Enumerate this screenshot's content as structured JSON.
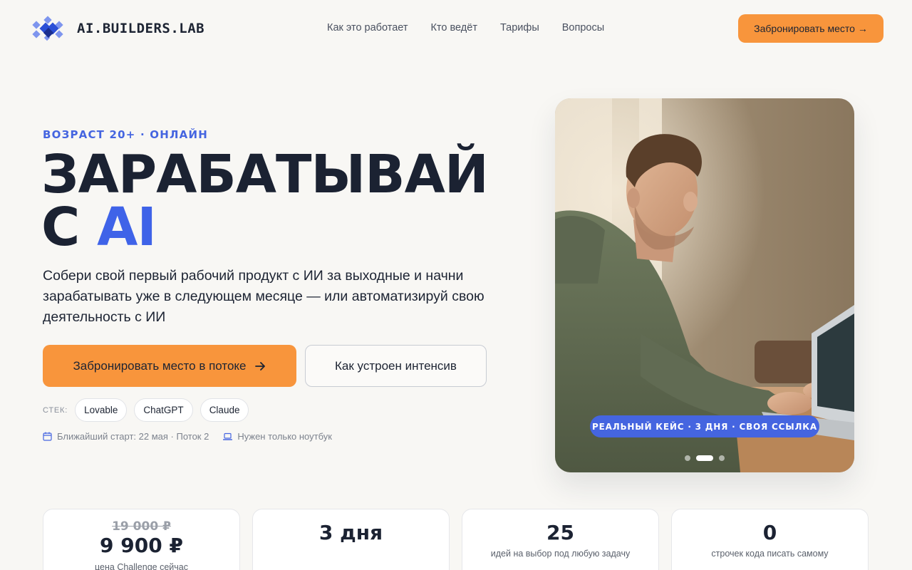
{
  "brand": {
    "name": "AI.BUILDERS.LAB"
  },
  "nav": {
    "links": [
      "Как это работает",
      "Кто ведёт",
      "Тарифы",
      "Вопросы"
    ],
    "cta": "Забронировать место →"
  },
  "hero": {
    "eyebrow": "ВОЗРАСТ 20+ · ОНЛАЙН",
    "headline_line1": "ЗАРАБАТЫВАЙ",
    "headline_line2_prefix": "С",
    "headline_line2_accent": "AI",
    "subtitle": "Собери свой первый рабочий продукт с ИИ за выходные и начни зарабатывать уже в следующем месяце — или автоматизируй свою деятельность с ИИ",
    "primary_button": "Забронировать место в потоке",
    "secondary_button": "Как устроен интенсив",
    "stack_label": "СТЕК:",
    "stack": [
      "Lovable",
      "ChatGPT",
      "Claude"
    ],
    "meta": {
      "start": "Ближайший старт: 22 мая · Поток 2",
      "requirement": "Нужен только ноутбук"
    }
  },
  "photo": {
    "badge": "РЕАЛЬНЫЙ КЕЙС · 3 ДНЯ · СВОЯ ССЫЛКА",
    "slides_count": 3,
    "active_slide": 2
  },
  "stats": [
    {
      "old_value": "19 000 ₽",
      "value": "9 900 ₽",
      "caption": "цена Challenge сейчас"
    },
    {
      "value": "3 дня",
      "caption": ""
    },
    {
      "value": "25",
      "caption": "идей на выбор под любую задачу"
    },
    {
      "value": "0",
      "caption": "строчек кода писать самому"
    }
  ],
  "colors": {
    "background": "#f8f7f4",
    "accent_orange": "#f8953c",
    "accent_blue": "#4565e0",
    "text_dark": "#1b2232"
  }
}
